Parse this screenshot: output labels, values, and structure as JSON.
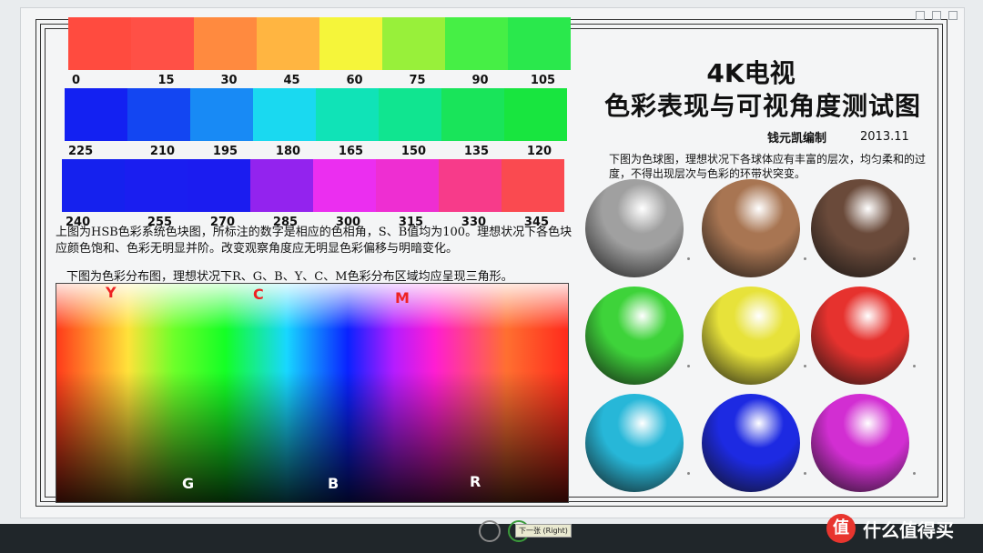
{
  "title_top": "4K电视",
  "title_main": "色彩表现与可视角度测试图",
  "author": "钱元凯编制",
  "date": "2013.11",
  "hsb": {
    "row1": {
      "labels": [
        "0",
        "15",
        "30",
        "45",
        "60",
        "75",
        "90",
        "105"
      ],
      "colors": [
        "#ff4b3f",
        "#ff5046",
        "#ff8a3f",
        "#ffb541",
        "#f5f53a",
        "#98f03a",
        "#46ef45",
        "#2ae84c"
      ]
    },
    "row2": {
      "labels": [
        "225",
        "210",
        "195",
        "180",
        "165",
        "150",
        "135",
        "120"
      ],
      "colors": [
        "#1321f2",
        "#1346f2",
        "#188af5",
        "#1ad9f0",
        "#10e3b7",
        "#10e590",
        "#19e45a",
        "#18e53f"
      ]
    },
    "row3": {
      "labels": [
        "240",
        "255",
        "270",
        "285",
        "300",
        "315",
        "330",
        "345"
      ],
      "colors": [
        "#1521ee",
        "#1a1ef0",
        "#1b1cf0",
        "#9323ee",
        "#eb2ef0",
        "#ee2ed2",
        "#f73b8a",
        "#fa4a50"
      ]
    }
  },
  "hsb_description": "上图为HSB色彩系统色块图，所标注的数字是相应的色相角，S、B值均为100。理想状况下各色块应颜色饱和、色彩无明显并阶。改变观察角度应无明显色彩偏移与明暗变化。",
  "dist_description": "下图为色彩分布图，理想状况下R、G、B、Y、C、M色彩分布区域均应呈现三角形。",
  "dist_labels": {
    "y": "Y",
    "c": "C",
    "m": "M",
    "g": "G",
    "b": "B",
    "r": "R"
  },
  "sphere_description": "下图为色球图，理想状况下各球体应有丰富的层次，均匀柔和的过度，不得出现层次与色彩的环带状突变。",
  "spheres": [
    {
      "name": "gray",
      "color": "#a0a0a0"
    },
    {
      "name": "brown",
      "color": "#a87552"
    },
    {
      "name": "dark-brown",
      "color": "#6a4a3a"
    },
    {
      "name": "green",
      "color": "#3ed33a"
    },
    {
      "name": "yellow",
      "color": "#e7e23a"
    },
    {
      "name": "red",
      "color": "#e6322e"
    },
    {
      "name": "cyan",
      "color": "#27b7d8"
    },
    {
      "name": "blue",
      "color": "#1d2ae2"
    },
    {
      "name": "magenta",
      "color": "#d22ed2"
    }
  ],
  "viewer": {
    "next_tooltip": "下一张 (Right)"
  },
  "watermark": {
    "badge": "值",
    "text": "什么值得买"
  }
}
